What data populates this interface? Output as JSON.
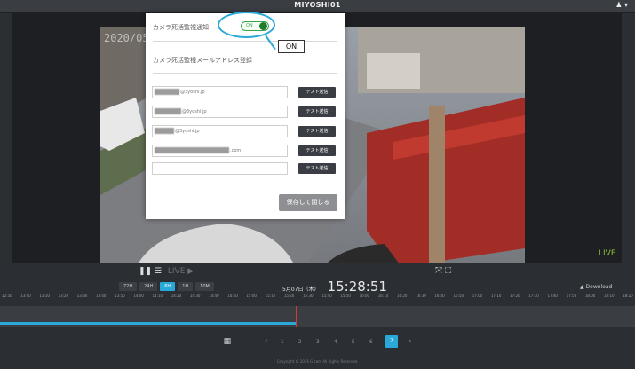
{
  "header": {
    "title": "MIYOSHI01",
    "user_menu": "♟ ▾"
  },
  "video": {
    "timestamp": "2020/05/0",
    "live_label": "LIVE"
  },
  "modal": {
    "notify_label": "カメラ死活監視通知",
    "toggle_text": "ON",
    "email_section_label": "カメラ死活監視メールアドレス登録",
    "annotation": "ON",
    "emails": [
      {
        "value": "@3yoshi.jp",
        "mask_width": 28,
        "test_label": "テスト送信"
      },
      {
        "value": "@3yoshi.jp",
        "mask_width": 30,
        "test_label": "テスト送信"
      },
      {
        "value": "@3yoshi.jp",
        "mask_width": 22,
        "test_label": "テスト送信"
      },
      {
        "value": ".com",
        "mask_width": 84,
        "test_label": "テスト送信"
      },
      {
        "value": "",
        "mask_width": 0,
        "test_label": "テスト送信"
      }
    ],
    "save_label": "保存して閉じる"
  },
  "controls": {
    "play_icons": "❚❚ ☰",
    "live_play": "LIVE ▶",
    "ranges": [
      {
        "label": "72H",
        "active": false
      },
      {
        "label": "24H",
        "active": false
      },
      {
        "label": "6H",
        "active": true
      },
      {
        "label": "1H",
        "active": false
      },
      {
        "label": "10M",
        "active": false
      }
    ],
    "date": "5月07日（木）",
    "time": "15:28:51",
    "fullscreen": "⤧ ⛶",
    "download": "▲ Download"
  },
  "timeline": {
    "ticks": [
      "12:50",
      "13:00",
      "13:10",
      "13:20",
      "13:30",
      "13:40",
      "13:50",
      "14:00",
      "14:10",
      "14:20",
      "14:30",
      "14:40",
      "14:50",
      "15:00",
      "15:10",
      "15:20",
      "15:30",
      "15:40",
      "15:50",
      "16:00",
      "16:10",
      "16:20",
      "16:30",
      "16:40",
      "16:50",
      "17:00",
      "17:10",
      "17:20",
      "17:30",
      "17:40",
      "17:50",
      "18:00",
      "18:10",
      "18:20"
    ],
    "progress": 0.466
  },
  "pager": {
    "calendar_icon": "calendar-icon",
    "prev": "‹",
    "next": "›",
    "pages": [
      {
        "label": "1",
        "active": false
      },
      {
        "label": "2",
        "active": false
      },
      {
        "label": "3",
        "active": false
      },
      {
        "label": "4",
        "active": false
      },
      {
        "label": "5",
        "active": false
      },
      {
        "label": "6",
        "active": false
      },
      {
        "label": "7",
        "active": true
      }
    ]
  },
  "footer": {
    "copyright": "Copyright © 2016 G cam All Rights Reserved."
  }
}
